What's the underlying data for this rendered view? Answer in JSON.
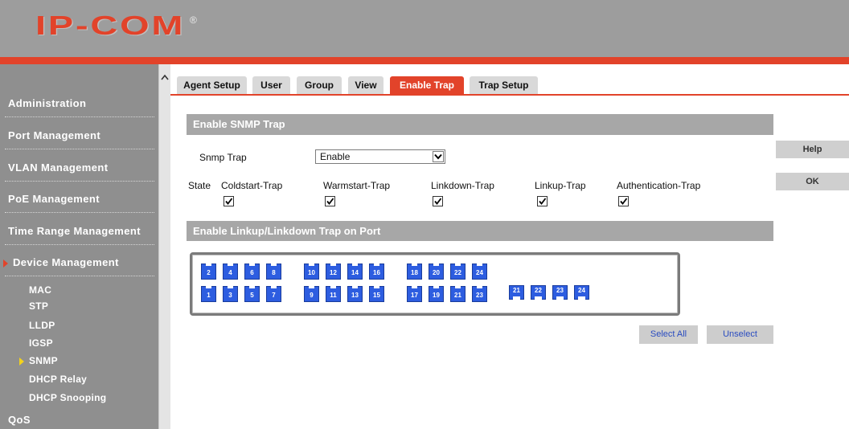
{
  "brand": {
    "logo": "IP-COM",
    "registered": "®"
  },
  "colors": {
    "header_bg": "#9d9d9d",
    "accent_red": "#e2432a",
    "sidebar_bg": "#8f8f8f",
    "section_bg": "#a7a7a7",
    "tab_bg": "#d9d9d9",
    "port_blue": "#2d5de0",
    "button_bg": "#cdcdcd",
    "button_text_blue": "#2a4cc0",
    "side_button_bg": "#cfcfcf"
  },
  "sidebar": {
    "menu": [
      {
        "label": "Administration"
      },
      {
        "label": "Port Management"
      },
      {
        "label": "VLAN Management"
      },
      {
        "label": "PoE Management"
      },
      {
        "label": "Time Range Management"
      },
      {
        "label": "Device Management",
        "expanded": true,
        "icon": "red-triangle-right-icon"
      }
    ],
    "submenu": [
      {
        "label": "MAC"
      },
      {
        "label": "STP"
      },
      {
        "label": "LLDP"
      },
      {
        "label": "IGSP"
      },
      {
        "label": "SNMP",
        "active": true,
        "icon": "yellow-triangle-right-icon"
      },
      {
        "label": "DHCP Relay"
      },
      {
        "label": "DHCP Snooping"
      }
    ],
    "trailing_menu": [
      {
        "label": "QoS"
      }
    ]
  },
  "scrollbar": {
    "icon": "scroll-up-arrow-icon"
  },
  "tabs": {
    "items": [
      {
        "label": "Agent Setup"
      },
      {
        "label": "User"
      },
      {
        "label": "Group"
      },
      {
        "label": "View"
      },
      {
        "label": "Enable Trap",
        "active": true
      },
      {
        "label": "Trap Setup"
      }
    ]
  },
  "snmp_section": {
    "title": "Enable SNMP Trap",
    "snmp_trap_label": "Snmp Trap",
    "snmp_trap_value": "Enable",
    "state_label": "State",
    "traps": [
      {
        "label": "Coldstart-Trap",
        "checked": true
      },
      {
        "label": "Warmstart-Trap",
        "checked": true
      },
      {
        "label": "Linkdown-Trap",
        "checked": true
      },
      {
        "label": "Linkup-Trap",
        "checked": true
      },
      {
        "label": "Authentication-Trap",
        "checked": true
      }
    ]
  },
  "side_buttons": {
    "help_label": "Help",
    "ok_label": "OK"
  },
  "port_section": {
    "title": "Enable Linkup/Linkdown Trap on Port",
    "top_row": [
      [
        "2",
        "4",
        "6",
        "8"
      ],
      [
        "10",
        "12",
        "14",
        "16"
      ],
      [
        "18",
        "20",
        "22",
        "24"
      ]
    ],
    "bottom_row": [
      [
        "1",
        "3",
        "5",
        "7"
      ],
      [
        "9",
        "11",
        "13",
        "15"
      ],
      [
        "17",
        "19",
        "21",
        "23"
      ]
    ],
    "sfp_ports": [
      "21",
      "22",
      "23",
      "24"
    ],
    "select_all_label": "Select All",
    "unselect_label": "Unselect"
  }
}
